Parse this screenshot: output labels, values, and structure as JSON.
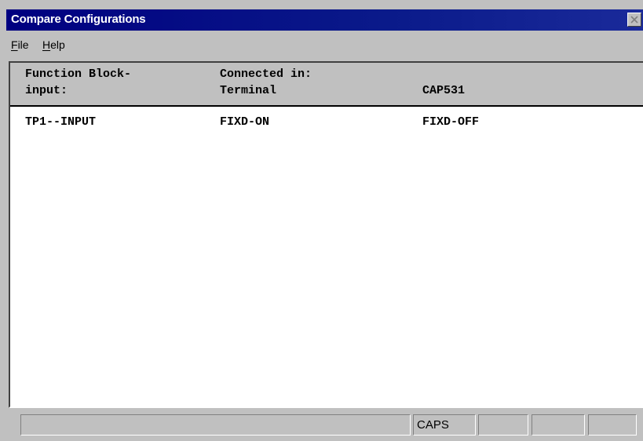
{
  "window": {
    "title": "Compare Configurations",
    "close_icon": "close-icon"
  },
  "menu": {
    "items": [
      {
        "mnemonic": "F",
        "rest": "ile"
      },
      {
        "mnemonic": "H",
        "rest": "elp"
      }
    ]
  },
  "table": {
    "headers": {
      "col1_line1": "Function Block-",
      "col1_line2": "input:",
      "col2_line1": "Connected in:",
      "col2_line2": "Terminal",
      "col3_line2": "CAP531"
    },
    "rows": [
      {
        "block": "TP1--INPUT",
        "terminal": "FIXD-ON",
        "cap531": "FIXD-OFF"
      }
    ]
  },
  "status": {
    "caps": "CAPS"
  }
}
